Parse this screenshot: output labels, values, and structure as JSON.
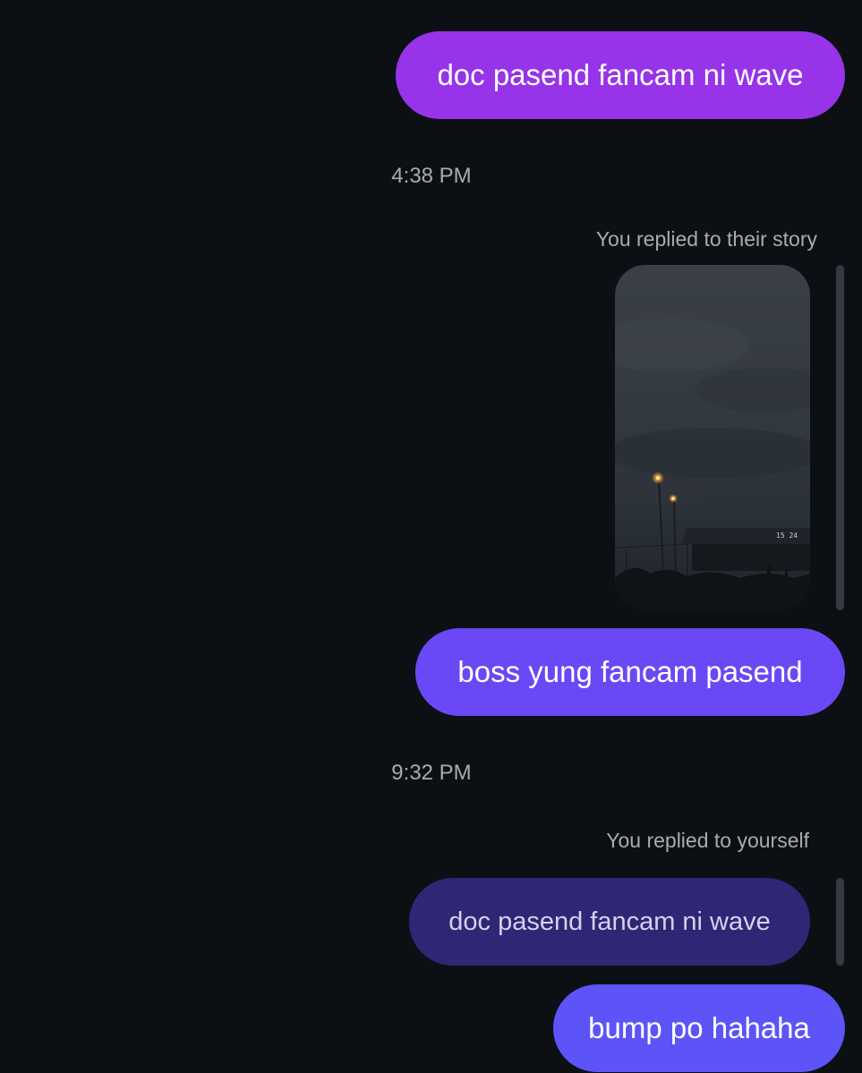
{
  "messages": [
    {
      "text": "doc pasend fancam ni wave",
      "color": "#9733e8"
    },
    {
      "text": "boss yung fancam pasend",
      "color": "#6b48f5"
    },
    {
      "text": "bump po hahaha",
      "color": "#5c54f7"
    }
  ],
  "timestamps": [
    "4:38 PM",
    "9:32 PM"
  ],
  "story_reply": {
    "label": "You replied to their story",
    "thumbnail_stamp": "15 24"
  },
  "self_reply": {
    "label": "You replied to yourself",
    "quoted_text": "doc pasend fancam ni wave",
    "color": "#2d2775"
  },
  "colors": {
    "background": "#0c1014",
    "meta_text": "#a8abb0"
  }
}
